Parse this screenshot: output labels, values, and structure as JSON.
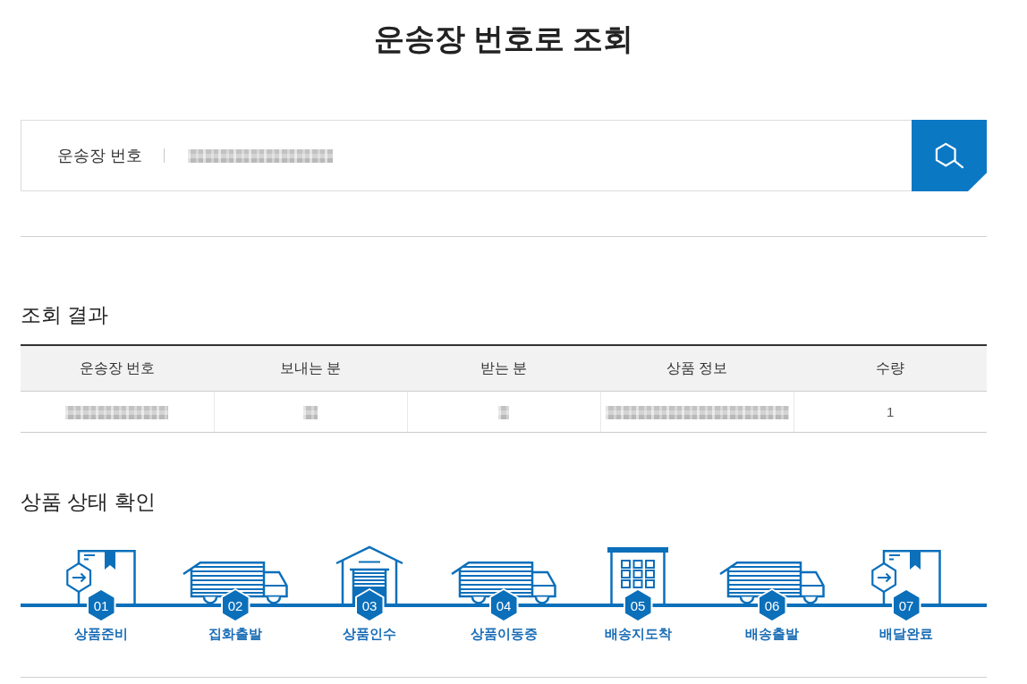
{
  "title": "운송장 번호로 조회",
  "search": {
    "label": "운송장 번호",
    "value_redacted": true
  },
  "results": {
    "heading": "조회 결과",
    "columns": [
      "운송장 번호",
      "보내는 분",
      "받는 분",
      "상품 정보",
      "수량"
    ],
    "rows": [
      [
        {
          "kind": "redacted"
        },
        {
          "kind": "redacted"
        },
        {
          "kind": "redacted"
        },
        {
          "kind": "redacted"
        },
        {
          "kind": "text",
          "text": "1"
        }
      ]
    ]
  },
  "status": {
    "heading": "상품 상태 확인",
    "steps": [
      {
        "number": "01",
        "label": "상품준비"
      },
      {
        "number": "02",
        "label": "집화출발"
      },
      {
        "number": "03",
        "label": "상품인수"
      },
      {
        "number": "04",
        "label": "상품이동중"
      },
      {
        "number": "05",
        "label": "배송지도착"
      },
      {
        "number": "06",
        "label": "배송출발"
      },
      {
        "number": "07",
        "label": "배달완료"
      }
    ]
  }
}
